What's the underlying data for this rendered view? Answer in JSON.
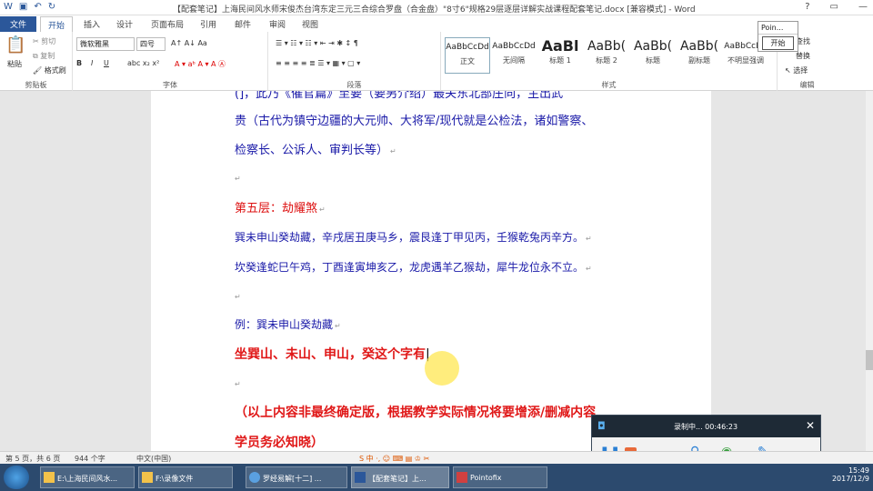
{
  "window": {
    "title": "【配套笔记】上海民间风水师宋俊杰台湾东定三元三合综合罗盘（合金盘）\"8寸6\"规格29层逐层详解实战课程配套笔记.docx [兼容模式] - Word"
  },
  "tabs": [
    "文件",
    "开始",
    "插入",
    "设计",
    "页面布局",
    "引用",
    "邮件",
    "审阅",
    "视图"
  ],
  "active_tab": "开始",
  "ribbon": {
    "clipboard": {
      "paste": "粘贴",
      "cut": "剪切",
      "copy": "复制",
      "format_painter": "格式刷",
      "label": "剪贴板"
    },
    "font": {
      "font_name": "微软雅黑",
      "font_size": "四号",
      "label": "字体"
    },
    "paragraph": {
      "label": "段落"
    },
    "styles": {
      "label": "样式",
      "items": [
        {
          "sample": "AaBbCcDd",
          "name": "正文"
        },
        {
          "sample": "AaBbCcDd",
          "name": "无间隔"
        },
        {
          "sample": "AaBl",
          "name": "标题 1"
        },
        {
          "sample": "AaBb(",
          "name": "标题 2"
        },
        {
          "sample": "AaBb(",
          "name": "标题"
        },
        {
          "sample": "AaBb(",
          "name": "副标题"
        },
        {
          "sample": "AaBbCcDd",
          "name": "不明显强调"
        }
      ]
    },
    "editing": {
      "find": "查找",
      "replace": "替换",
      "select": "选择",
      "label": "编辑"
    }
  },
  "pointofix_popup": {
    "title": "Poin...",
    "button": "开始"
  },
  "document": {
    "line0": "(]，此乃《催官篇》至要（要另介绍）最关东北部庄向，主出武",
    "line1": "贵（古代为镇守边疆的大元帅、大将军/现代就是公检法，诸如警察、",
    "line2": "检察长、公诉人、审判长等）",
    "heading": "第五层：劫耀煞",
    "line3": "巽未申山癸劫藏，辛戌居丑庚马乡，震艮逢丁甲见丙，壬猴乾兔丙辛方。",
    "line4": "坎癸逢蛇巳午鸡，丁酉逢寅坤亥乙，龙虎遇羊乙猴劫，犀牛龙位永不立。",
    "example": "例：巽未申山癸劫藏",
    "bold1": "坐巽山、未山、申山，癸这个字有",
    "bold2": "（以上内容非最终确定版，根据教学实际情况将要增添/删减内容",
    "bold3": "学员务必知晓）"
  },
  "statusbar": {
    "page": "第 5 页，共 6 页",
    "words": "944 个字",
    "lang": "中文(中国)"
  },
  "recorder": {
    "status": "录制中... 00:46:23"
  },
  "taskbar": {
    "items": [
      "E:\\上海民间风水...",
      "F:\\录像文件",
      "罗经易解[十二] ...",
      "【配套笔记】上...",
      "Pointofix"
    ],
    "time": "15:49",
    "date": "2017/12/9"
  }
}
